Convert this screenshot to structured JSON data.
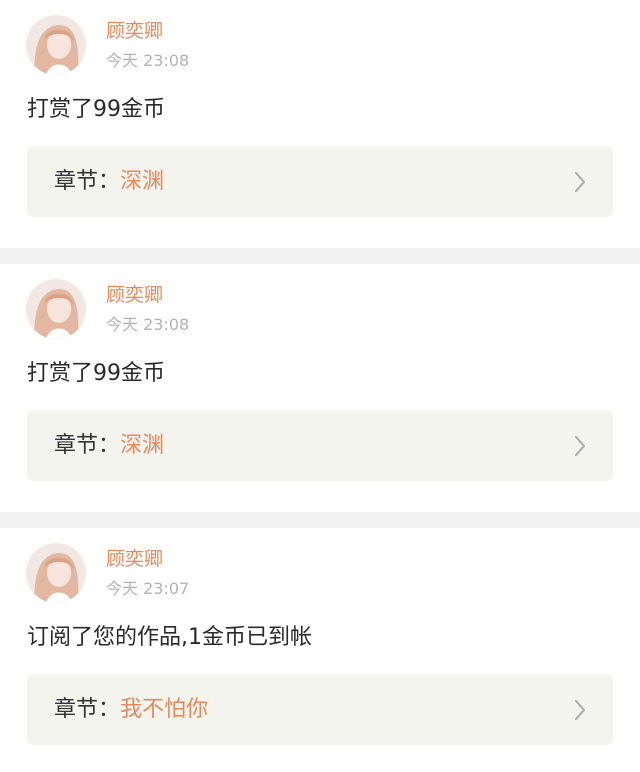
{
  "feed": [
    {
      "user": "顾奕卿",
      "time": "今天 23:08",
      "message": "打赏了99金币",
      "chapter_label": "章节：",
      "chapter_title": "深渊"
    },
    {
      "user": "顾奕卿",
      "time": "今天 23:08",
      "message": "打赏了99金币",
      "chapter_label": "章节：",
      "chapter_title": "深渊"
    },
    {
      "user": "顾奕卿",
      "time": "今天 23:07",
      "message": "订阅了您的作品,1金币已到帐",
      "chapter_label": "章节：",
      "chapter_title": "我不怕你"
    }
  ],
  "colors": {
    "accent": "#e8895a",
    "background": "#f2f2f2",
    "chapter_box": "#f4f4ef"
  },
  "icons": {
    "chevron": "chevron-right-icon",
    "avatar": "avatar"
  }
}
